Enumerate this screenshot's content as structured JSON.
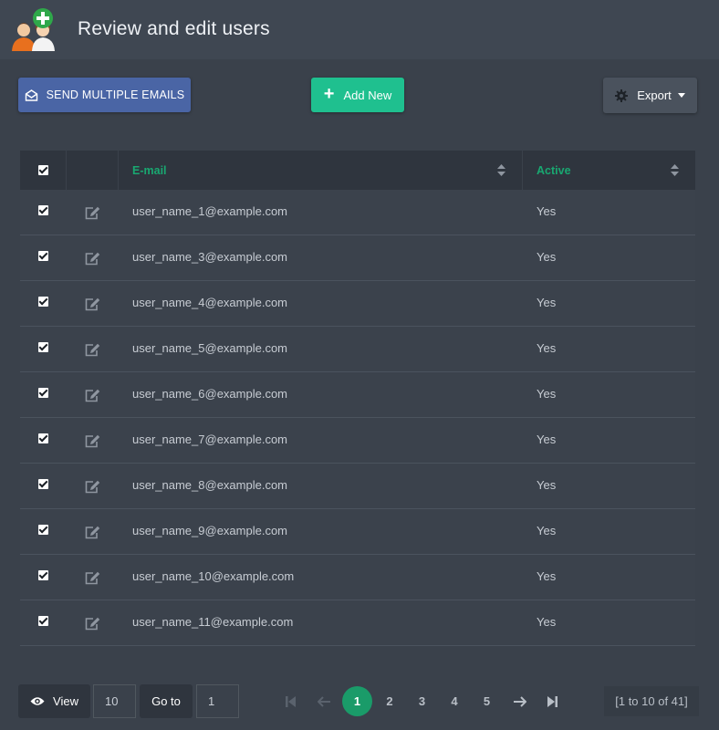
{
  "header": {
    "title": "Review and edit users",
    "icon": "users-add-icon"
  },
  "toolbar": {
    "send_emails_label": "SEND MULTIPLE EMAILS",
    "add_new_label": "Add New",
    "export_label": "Export"
  },
  "table": {
    "columns": [
      "E-mail",
      "Active"
    ],
    "rows": [
      {
        "email": "user_name_1@example.com",
        "active": "Yes"
      },
      {
        "email": "user_name_3@example.com",
        "active": "Yes"
      },
      {
        "email": "user_name_4@example.com",
        "active": "Yes"
      },
      {
        "email": "user_name_5@example.com",
        "active": "Yes"
      },
      {
        "email": "user_name_6@example.com",
        "active": "Yes"
      },
      {
        "email": "user_name_7@example.com",
        "active": "Yes"
      },
      {
        "email": "user_name_8@example.com",
        "active": "Yes"
      },
      {
        "email": "user_name_9@example.com",
        "active": "Yes"
      },
      {
        "email": "user_name_10@example.com",
        "active": "Yes"
      },
      {
        "email": "user_name_11@example.com",
        "active": "Yes"
      }
    ]
  },
  "footer": {
    "view_label": "View",
    "rows_per_page": "10",
    "goto_label": "Go to",
    "goto_page": "1",
    "pages": [
      "1",
      "2",
      "3",
      "4",
      "5"
    ],
    "current_page": "1",
    "range_text": "[1 to 10 of 41]"
  },
  "colors": {
    "accent_green": "#1fc08f",
    "primary_blue": "#4a65a5",
    "header_label": "#19a871",
    "background": "#3a414b"
  }
}
